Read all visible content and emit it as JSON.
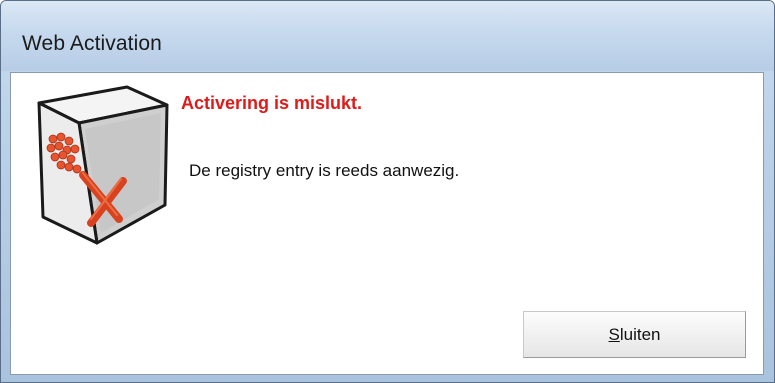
{
  "window": {
    "title": "Web Activation"
  },
  "dialog": {
    "heading": "Activering is mislukt.",
    "message": "De registry entry is reeds aanwezig.",
    "icon": "server-box-error-icon",
    "heading_color": "#e01a1a"
  },
  "buttons": {
    "close": {
      "accelerator": "S",
      "rest": "luiten"
    }
  }
}
